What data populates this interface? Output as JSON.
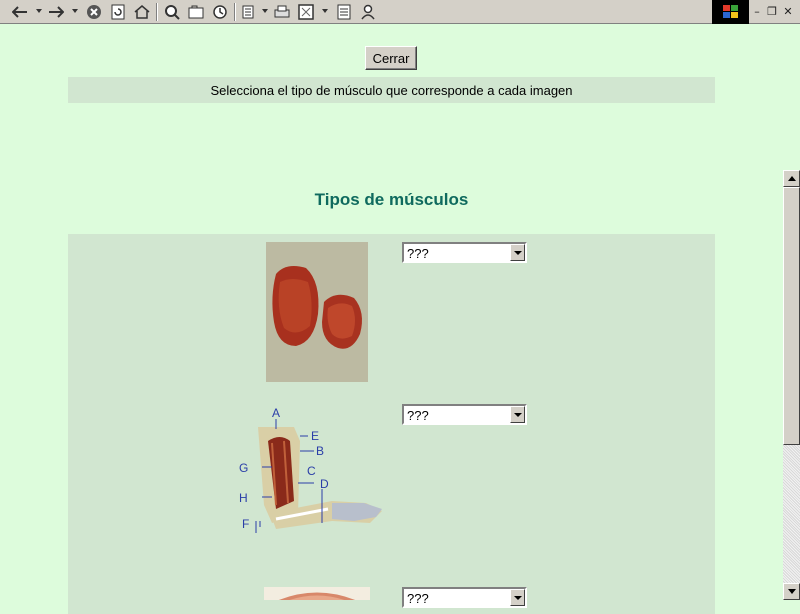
{
  "toolbar": {
    "icons": [
      "back-icon",
      "forward-icon",
      "stop-icon",
      "refresh-icon",
      "home-icon",
      "search-icon",
      "favorites-icon",
      "history-icon",
      "edit-icon",
      "print-icon",
      "fullscreen-icon",
      "page-icon",
      "user-icon"
    ],
    "window_controls": {
      "minimize": "–",
      "restore": "❐",
      "close": "✕"
    }
  },
  "close_button": {
    "label": "Cerrar"
  },
  "instruction": "Selecciona el tipo de músculo que corresponde a cada imagen",
  "section_title": "Tipos de músculos",
  "questions": [
    {
      "image": "heart-muscle-image",
      "select": {
        "value": "???"
      }
    },
    {
      "image": "arm-muscle-diagram",
      "select": {
        "value": "???"
      },
      "labels": [
        "A",
        "E",
        "B",
        "G",
        "C",
        "D",
        "H",
        "F"
      ]
    },
    {
      "image": "smooth-muscle-image",
      "select": {
        "value": "???"
      }
    }
  ],
  "colors": {
    "page_bg": "#ddfcdc",
    "panel_bg": "#d1e6d0",
    "title": "#0f6a5e",
    "toolbar_bg": "#d4d0c8"
  }
}
